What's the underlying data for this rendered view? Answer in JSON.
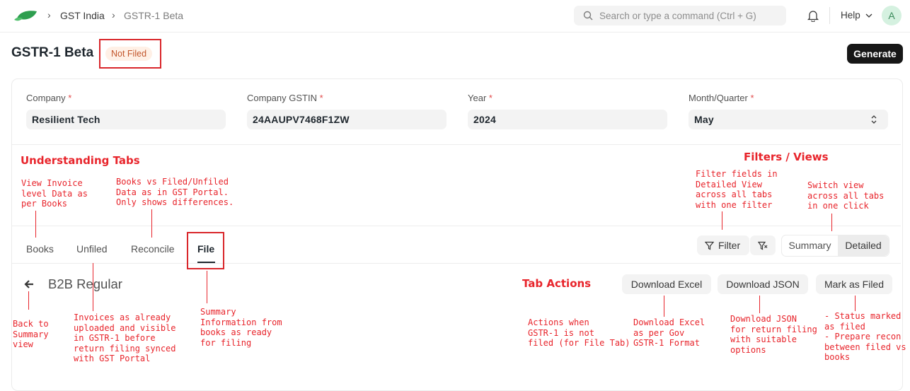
{
  "navbar": {
    "breadcrumbs": [
      "GST India",
      "GSTR-1 Beta"
    ],
    "search_placeholder": "Search or type a command (Ctrl + G)",
    "help_label": "Help",
    "avatar_initial": "A"
  },
  "page": {
    "title": "GSTR-1 Beta",
    "status": "Not Filed",
    "generate_label": "Generate"
  },
  "form": {
    "fields": [
      {
        "label": "Company",
        "value": "Resilient Tech"
      },
      {
        "label": "Company GSTIN",
        "value": "24AAUPV7468F1ZW"
      },
      {
        "label": "Year",
        "value": "2024"
      },
      {
        "label": "Month/Quarter",
        "value": "May"
      }
    ],
    "required_mark": "*"
  },
  "tabs": [
    "Books",
    "Unfiled",
    "Reconcile",
    "File"
  ],
  "active_tab": "File",
  "toolbar": {
    "filter_label": "Filter",
    "views": [
      "Summary",
      "Detailed"
    ],
    "active_view": "Detailed"
  },
  "section": {
    "title": "B2B Regular",
    "actions": [
      "Download Excel",
      "Download JSON",
      "Mark as Filed"
    ]
  },
  "annotations": {
    "understanding_tabs": "Understanding Tabs",
    "filters_views": "Filters / Views",
    "tab_actions": "Tab Actions",
    "books_note": "View Invoice\nlevel Data as\nper Books",
    "reconcile_note": "Books vs Filed/Unfiled\nData as in GST Portal.\nOnly shows differences.",
    "filter_note": "Filter fields in\nDetailed View\nacross all tabs\nwith one filter",
    "switch_note": "Switch view\nacross all tabs\nin one click",
    "back_note": "Back to\nSummary\nview",
    "unfiled_note": "Invoices as already\nuploaded and visible\nin GSTR-1 before\nreturn filing synced\nwith GST Portal",
    "file_note": "Summary\nInformation from\nbooks as ready\nfor filing",
    "actions_note": "Actions when\nGSTR-1 is not\nfiled (for File Tab)",
    "excel_note": "Download Excel\nas per Gov\nGSTR-1 Format",
    "json_note": "Download JSON\nfor return filing\nwith suitable\noptions",
    "mark_note": "- Status marked\nas filed\n- Prepare recon\nbetween filed vs\nbooks"
  },
  "colors": {
    "annotation": "#e8242b",
    "primary_button": "#171717",
    "status_bg": "#fff0e6",
    "status_text": "#c2552b"
  }
}
